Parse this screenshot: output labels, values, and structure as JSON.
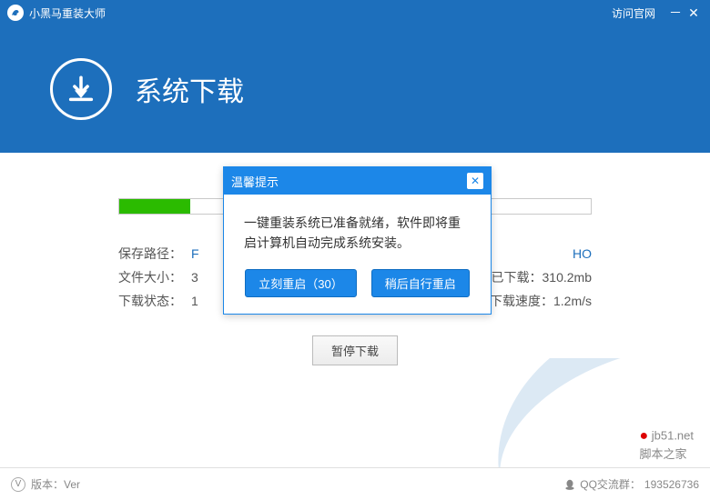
{
  "titlebar": {
    "app_name": "小黑马重装大师",
    "visit_link": "访问官网"
  },
  "header": {
    "title": "系统下载"
  },
  "download": {
    "save_path_label": "保存路径：",
    "save_path_value": "F",
    "save_path_suffix": "HO",
    "file_size_label": "文件大小：",
    "file_size_value": "3",
    "downloaded_label": "已下载：",
    "downloaded_value": "310.2mb",
    "status_label": "下载状态：",
    "status_value": "1",
    "speed_label": "下载速度：",
    "speed_value": "1.2m/s",
    "pause_button": "暂停下载"
  },
  "dialog": {
    "title": "温馨提示",
    "message": "一键重装系统已准备就绪，软件即将重启计算机自动完成系统安装。",
    "restart_now": "立刻重启（30）",
    "restart_later": "稍后自行重启"
  },
  "footer": {
    "version_label": "版本：Ver",
    "qq_label": "QQ交流群：",
    "qq_number": "193526736"
  },
  "watermark": {
    "site": "jb51.net",
    "name": "脚本之家"
  }
}
